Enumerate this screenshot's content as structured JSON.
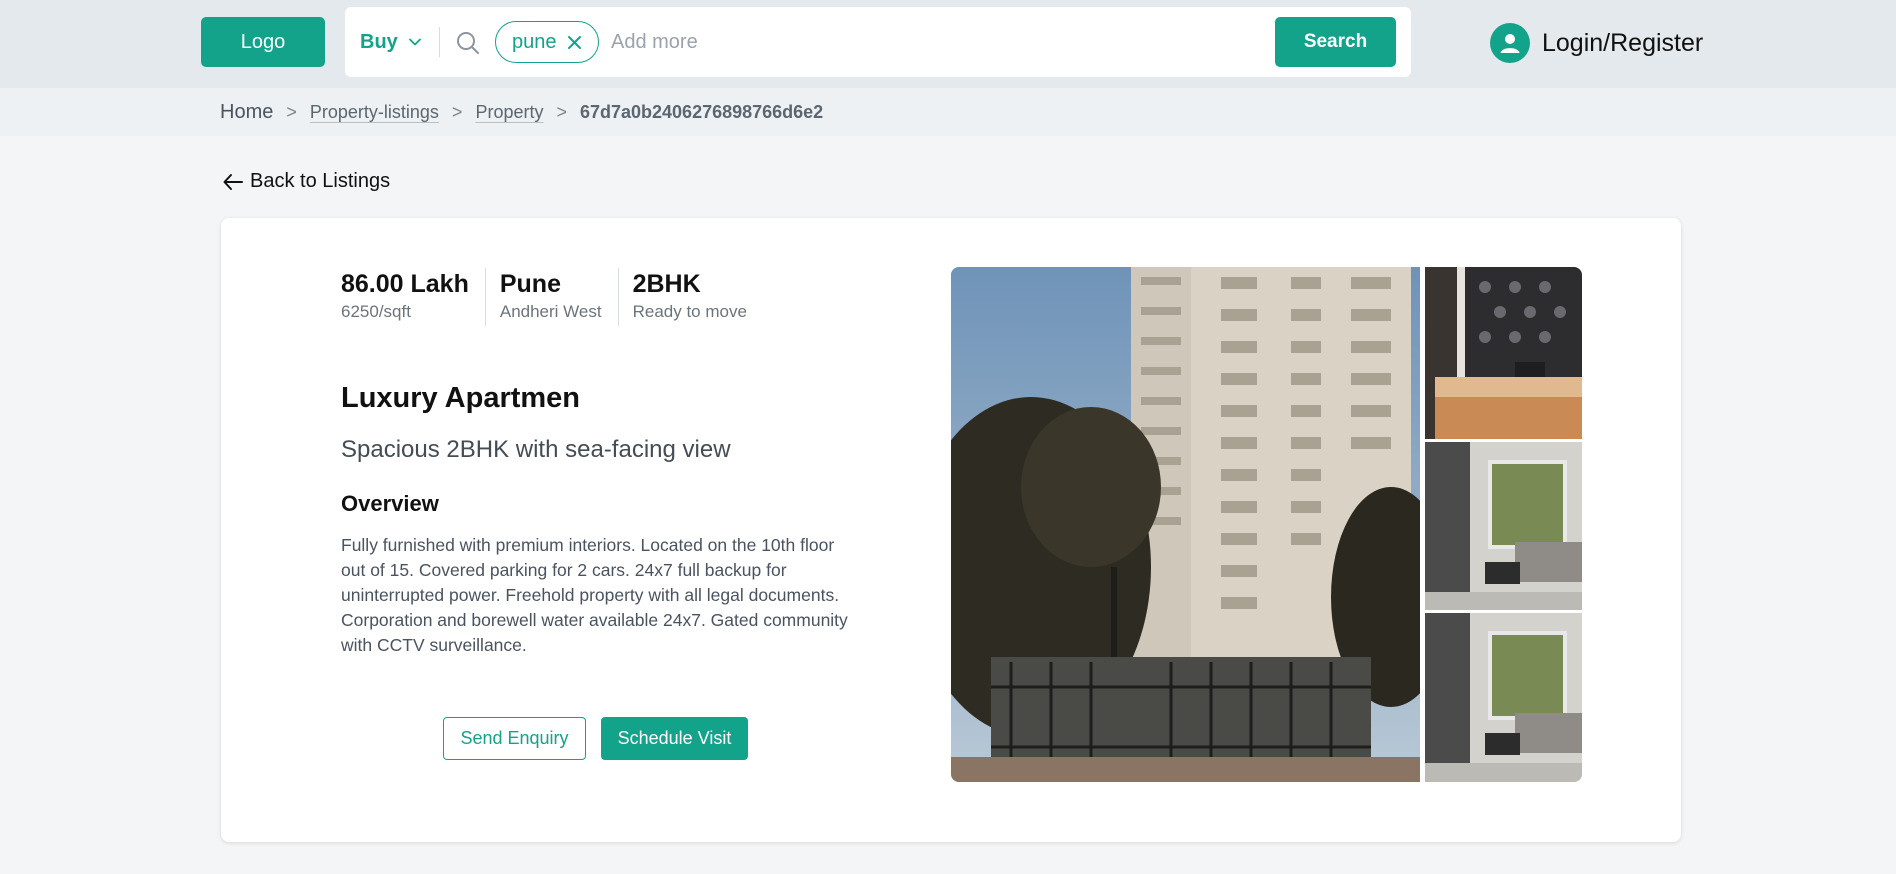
{
  "header": {
    "logo_label": "Logo",
    "buy_label": "Buy",
    "chip_label": "pune",
    "search_placeholder": "Add more",
    "search_button": "Search",
    "login_label": "Login/Register"
  },
  "breadcrumb": {
    "home": "Home",
    "sep": ">",
    "listings": "Property-listings",
    "property": "Property",
    "current": "67d7a0b2406276898766d6e2"
  },
  "back_label": "Back to Listings",
  "property": {
    "stats": [
      {
        "value": "86.00 Lakh",
        "sub": "6250/sqft"
      },
      {
        "value": "Pune",
        "sub": "Andheri West"
      },
      {
        "value": "2BHK",
        "sub": "Ready to move"
      }
    ],
    "title": "Luxury Apartmen",
    "subtitle": "Spacious 2BHK with sea-facing view",
    "overview_heading": "Overview",
    "description": "Fully furnished with premium interiors. Located on the 10th floor out of 15. Covered parking for 2 cars. 24x7 full backup for uninterrupted power. Freehold property with all legal documents. Corporation and borewell water available 24x7. Gated community with CCTV surveillance.",
    "enquiry_button": "Send Enquiry",
    "visit_button": "Schedule Visit"
  },
  "colors": {
    "accent": "#13a38b",
    "header_bg": "#e4e9ed",
    "page_bg": "#f3f5f7"
  }
}
